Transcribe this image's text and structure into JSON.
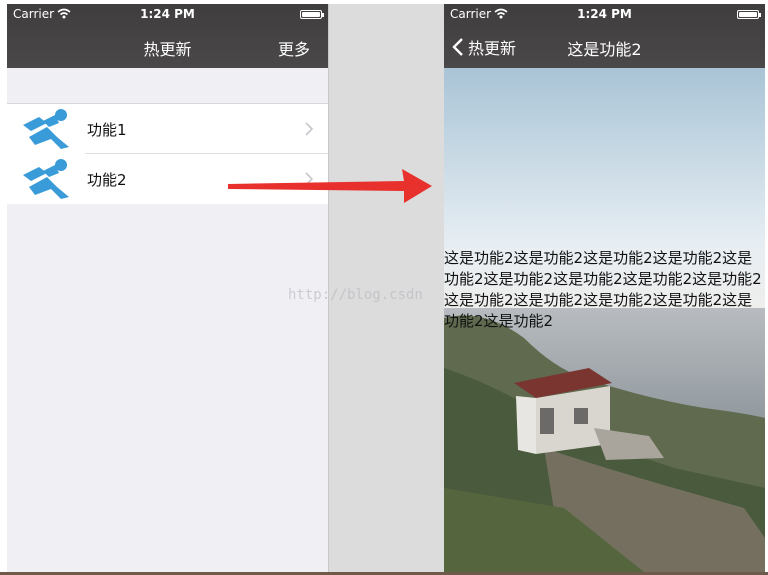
{
  "left": {
    "status": {
      "carrier": "Carrier",
      "time": "1:24 PM"
    },
    "nav": {
      "title": "热更新",
      "right_button": "更多"
    },
    "items": [
      {
        "label": "功能1",
        "icon": "runner-icon"
      },
      {
        "label": "功能2",
        "icon": "runner-icon"
      }
    ]
  },
  "right": {
    "status": {
      "carrier": "Carrier",
      "time": "1:24 PM"
    },
    "nav": {
      "back_label": "热更新",
      "title": "这是功能2"
    },
    "content_text": "这是功能2这是功能2这是功能2这是功能2这是功能2这是功能2这是功能2这是功能2这是功能2这是功能2这是功能2这是功能2这是功能2这是功能2这是功能2"
  },
  "watermark": "http://blog.csdn",
  "colors": {
    "nav_bg": "#434142",
    "list_bg": "#efeff4",
    "arrow": "#e8302c",
    "icon_blue": "#3a9bd9"
  }
}
